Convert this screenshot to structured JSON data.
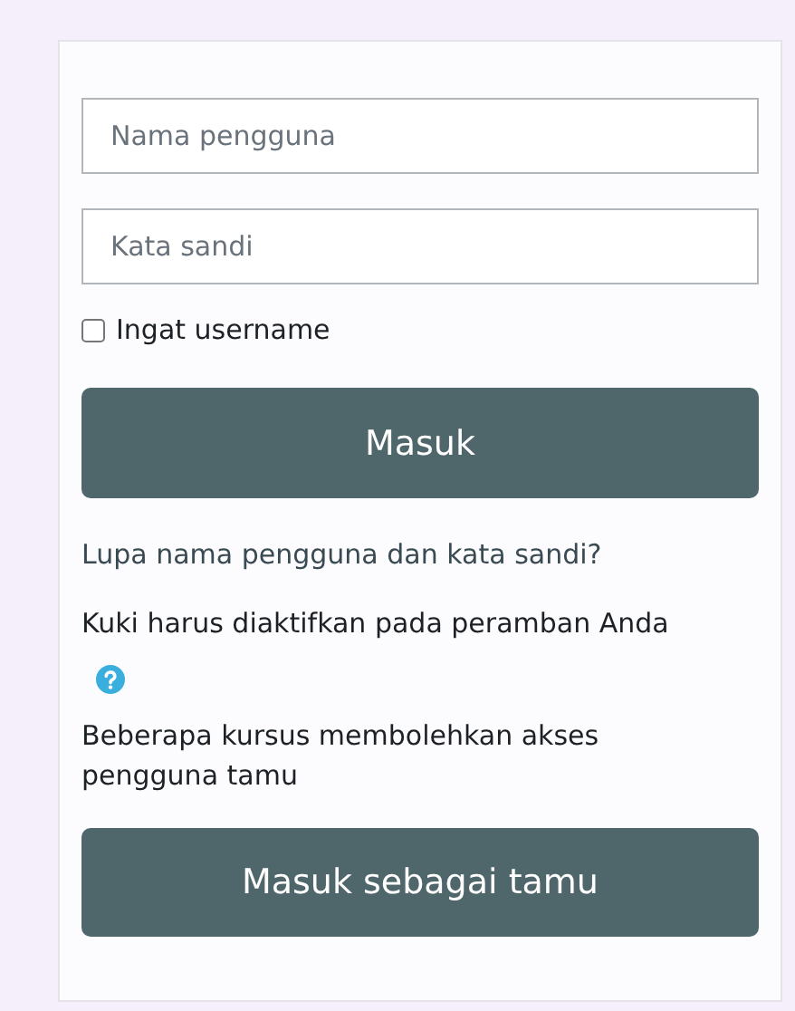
{
  "fields": [
    {
      "placeholder": "Nama pengguna"
    },
    {
      "placeholder": "Kata sandi"
    }
  ],
  "remember": {
    "label": "Ingat username",
    "checked": false
  },
  "login_button": "Masuk",
  "forgot_link": "Lupa nama pengguna dan kata sandi?",
  "cookies_notice": "Kuki harus diaktifkan pada peramban Anda",
  "guest_notice": "Beberapa kursus membolehkan akses pengguna tamu",
  "guest_button": "Masuk sebagai tamu"
}
